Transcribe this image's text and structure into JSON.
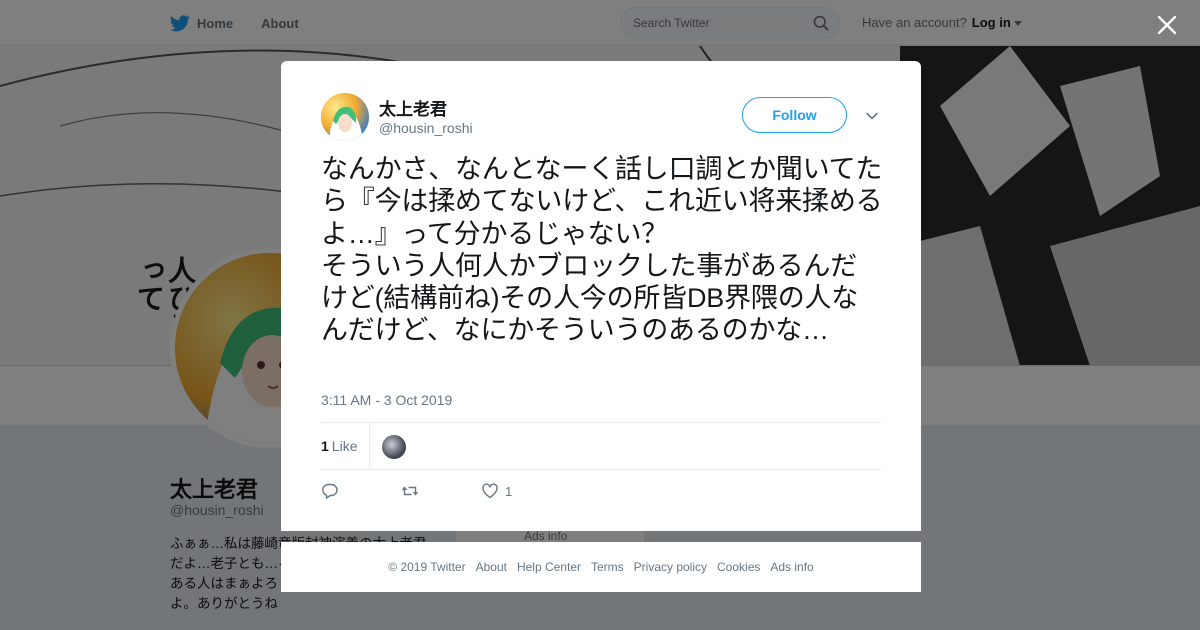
{
  "nav": {
    "home": "Home",
    "about": "About",
    "search_placeholder": "Search Twitter",
    "have_account": "Have an account?",
    "login": "Log in"
  },
  "banner": {
    "text": "人ひとって"
  },
  "profile": {
    "name": "太上老君",
    "handle": "@housin_roshi",
    "bio": "ふぁぁ…私は藤崎竜版封神演義の太上老君だよ…老子とも…ろん非公式だから…味がある人はまぁよろしく。アイコンは貰ったよ。ありがとうね",
    "ads_info": "Ads info"
  },
  "tweet": {
    "author_name": "太上老君",
    "author_handle": "@housin_roshi",
    "follow_label": "Follow",
    "text": "なんかさ、なんとなーく話し口調とか聞いてたら『今は揉めてないけど、これ近い将来揉めるよ…』って分かるじゃない？\nそういう人何人かブロックした事があるんだけど(結構前ね)その人今の所皆DB界隈の人なんだけど、なにかそういうのあるのかな…",
    "timestamp": "3:11 AM - 3 Oct 2019",
    "like_count": "1",
    "like_label": "Like",
    "action_like_count": "1"
  },
  "footer": {
    "links": [
      "© 2019 Twitter",
      "About",
      "Help Center",
      "Terms",
      "Privacy policy",
      "Cookies",
      "Ads info"
    ]
  },
  "colors": {
    "accent": "#1da1f2",
    "secondary_text": "#657786"
  },
  "icons": [
    "twitter-bird-icon",
    "search-icon",
    "close-icon",
    "chevron-down-icon",
    "reply-icon",
    "retweet-icon",
    "heart-icon"
  ]
}
